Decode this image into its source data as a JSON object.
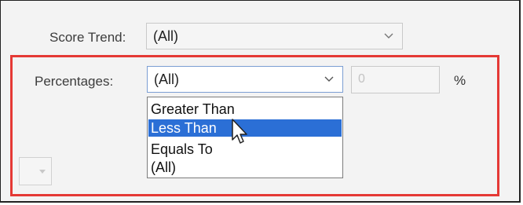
{
  "score_trend": {
    "label": "Score Trend:",
    "value": "(All)"
  },
  "percentages": {
    "label": "Percentages:",
    "value": "(All)",
    "options": [
      "Greater Than",
      "Less Than",
      "Equals To",
      "(All)"
    ],
    "highlighted_option": "Less Than"
  },
  "threshold": {
    "value": "0",
    "unit": "%"
  },
  "colors": {
    "highlight_box": "#e53935",
    "selected_option": "#2b6fd6"
  }
}
